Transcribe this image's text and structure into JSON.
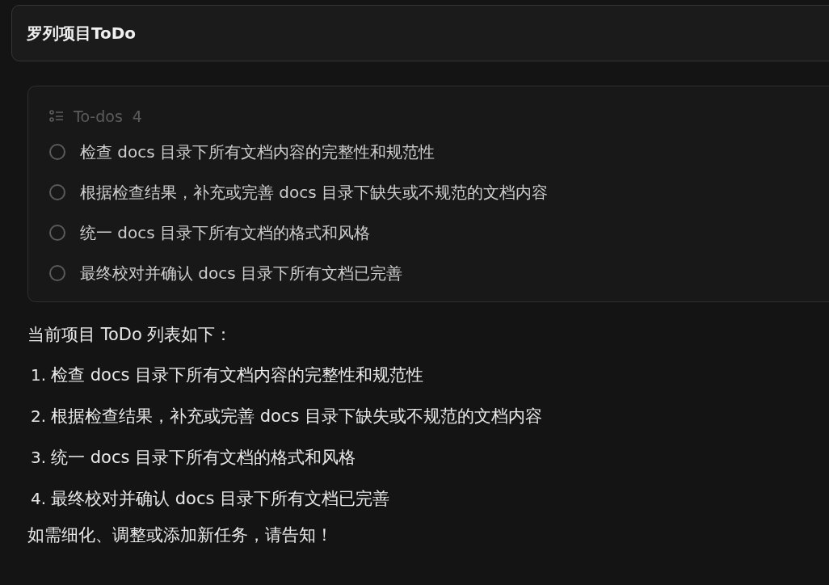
{
  "prompt": {
    "value": "罗列项目ToDo"
  },
  "todos": {
    "title": "To-dos",
    "count": "4",
    "items": [
      {
        "text": "检查 docs 目录下所有文档内容的完整性和规范性",
        "checked": false
      },
      {
        "text": "根据检查结果，补充或完善 docs 目录下缺失或不规范的文档内容",
        "checked": false
      },
      {
        "text": "统一 docs 目录下所有文档的格式和风格",
        "checked": false
      },
      {
        "text": "最终校对并确认 docs 目录下所有文档已完善",
        "checked": false
      }
    ]
  },
  "reply": {
    "intro": "当前项目 ToDo 列表如下：",
    "list": [
      {
        "number": "1.",
        "text": "检查 docs 目录下所有文档内容的完整性和规范性"
      },
      {
        "number": "2.",
        "text": "根据检查结果，补充或完善 docs 目录下缺失或不规范的文档内容"
      },
      {
        "number": "3.",
        "text": "统一 docs 目录下所有文档的格式和风格"
      },
      {
        "number": "4.",
        "text": "最终校对并确认 docs 目录下所有文档已完善"
      }
    ],
    "closing": "如需细化、调整或添加新任务，请告知！"
  }
}
